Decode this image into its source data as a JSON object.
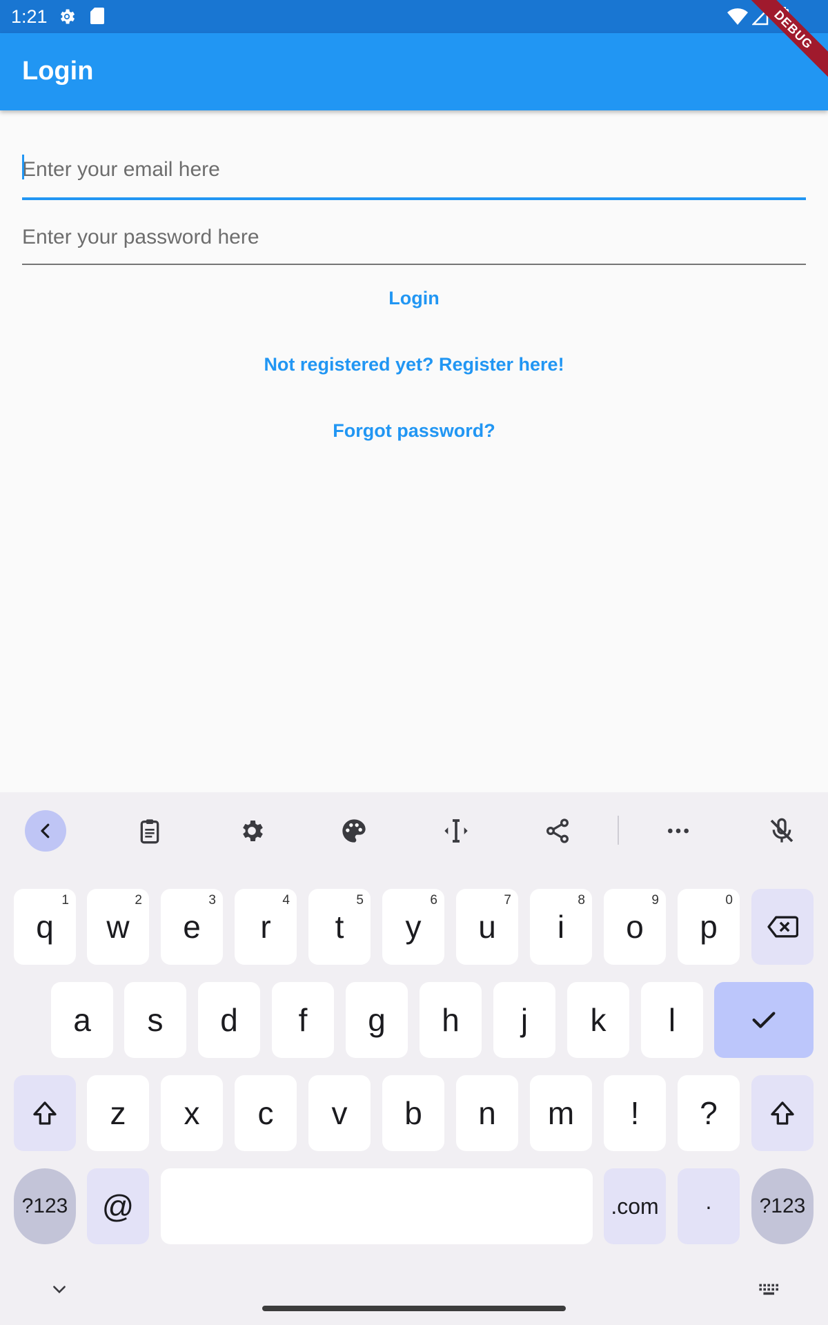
{
  "status_bar": {
    "time": "1:21"
  },
  "debug_banner": {
    "label": "DEBUG"
  },
  "app_bar": {
    "title": "Login"
  },
  "form": {
    "email_placeholder": "Enter your email here",
    "password_placeholder": "Enter your password here",
    "login_label": "Login",
    "register_label": "Not registered yet? Register here!",
    "forgot_label": "Forgot password?"
  },
  "keyboard": {
    "toolbar": [
      "back-icon",
      "clipboard-icon",
      "settings-icon",
      "palette-icon",
      "text-cursor-icon",
      "share-icon",
      "more-icon",
      "mic-off-icon"
    ],
    "row1": [
      {
        "key": "q",
        "hint": "1"
      },
      {
        "key": "w",
        "hint": "2"
      },
      {
        "key": "e",
        "hint": "3"
      },
      {
        "key": "r",
        "hint": "4"
      },
      {
        "key": "t",
        "hint": "5"
      },
      {
        "key": "y",
        "hint": "6"
      },
      {
        "key": "u",
        "hint": "7"
      },
      {
        "key": "i",
        "hint": "8"
      },
      {
        "key": "o",
        "hint": "9"
      },
      {
        "key": "p",
        "hint": "0"
      }
    ],
    "row2": [
      "a",
      "s",
      "d",
      "f",
      "g",
      "h",
      "j",
      "k",
      "l"
    ],
    "row3": [
      "z",
      "x",
      "c",
      "v",
      "b",
      "n",
      "m",
      "!",
      "?"
    ],
    "symbols_label": "?123",
    "at_label": "@",
    "dotcom_label": ".com",
    "period_label": "·",
    "colors": {
      "accent": "#bcc6fb",
      "function_key": "#e3e2f7",
      "key": "#ffffff",
      "background": "#f1eff3"
    }
  },
  "colors": {
    "primary": "#2196f3",
    "status_bar": "#1976d2",
    "debug_ribbon": "#a01a2d"
  }
}
